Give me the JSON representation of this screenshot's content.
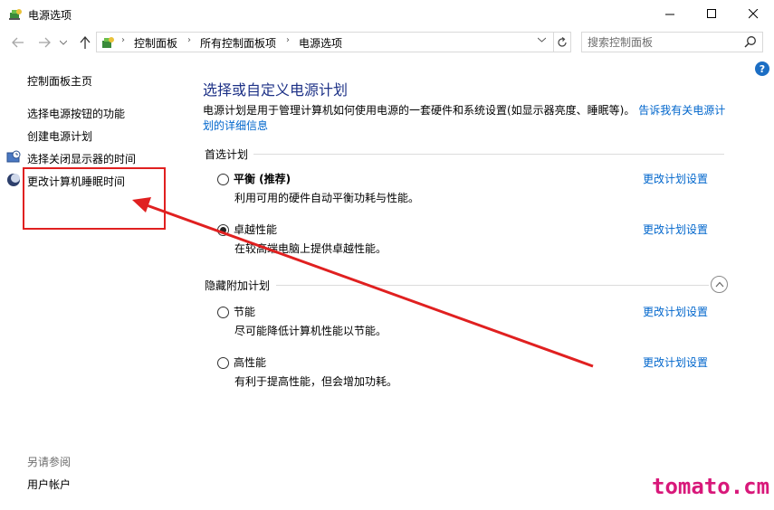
{
  "window": {
    "title": "电源选项",
    "controls": {
      "minimize": "—",
      "maximize": "☐",
      "close": "✕"
    }
  },
  "navigation": {
    "breadcrumb": [
      "控制面板",
      "所有控制面板项",
      "电源选项"
    ],
    "search_placeholder": "搜索控制面板"
  },
  "sidebar": {
    "home": "控制面板主页",
    "links": [
      "选择电源按钮的功能",
      "创建电源计划",
      "选择关闭显示器的时间",
      "更改计算机睡眠时间"
    ],
    "see_also_header": "另请参阅",
    "see_also": [
      "用户帐户"
    ]
  },
  "main": {
    "title": "选择或自定义电源计划",
    "description": "电源计划是用于管理计算机如何使用电源的一套硬件和系统设置(如显示器亮度、睡眠等)。",
    "description_link": "告诉我有关电源计划的详细信息",
    "preferred_header": "首选计划",
    "hidden_header": "隐藏附加计划",
    "change_label": "更改计划设置",
    "preferred_plans": [
      {
        "name": "平衡 (推荐)",
        "desc": "利用可用的硬件自动平衡功耗与性能。",
        "selected": false
      },
      {
        "name": "卓越性能",
        "desc": "在较高端电脑上提供卓越性能。",
        "selected": true
      }
    ],
    "hidden_plans": [
      {
        "name": "节能",
        "desc": "尽可能降低计算机性能以节能。",
        "selected": false
      },
      {
        "name": "高性能",
        "desc": "有利于提高性能，但会增加功耗。",
        "selected": false
      }
    ]
  },
  "help_label": "?",
  "annotation": {
    "color": "#e02020"
  },
  "watermark": "tomato.cm",
  "colors": {
    "link": "#0066cc",
    "title": "#1e3287",
    "watermark": "#d8187a"
  }
}
